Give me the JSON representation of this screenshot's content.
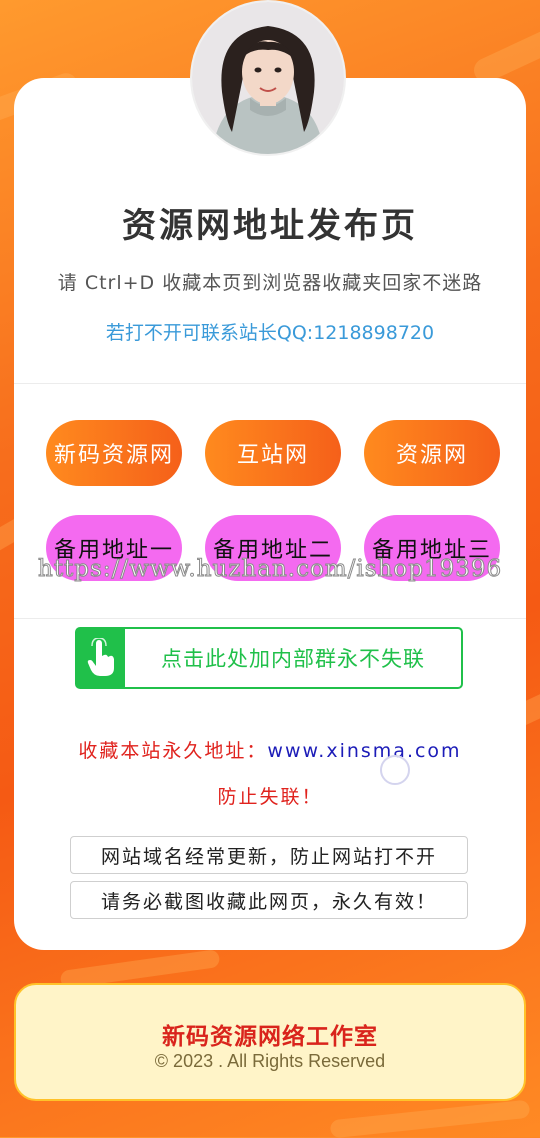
{
  "header": {
    "title": "资源网地址发布页",
    "subtitle": "请 Ctrl+D 收藏本页到浏览器收藏夹回家不迷路",
    "contact": "若打不开可联系站长QQ:1218898720"
  },
  "nav": {
    "primary": [
      {
        "label": "新码资源网"
      },
      {
        "label": "互站网"
      },
      {
        "label": "资源网"
      }
    ],
    "backup": [
      {
        "label": "备用地址一"
      },
      {
        "label": "备用地址二"
      },
      {
        "label": "备用地址三"
      }
    ]
  },
  "watermark": "https://www.huzhan.com/ishop19396",
  "group_button": {
    "label": "点击此处加内部群永不失联",
    "icon": "hand-pointer-icon"
  },
  "address": {
    "label": "收藏本站永久地址：",
    "url": "www.xinsma.com",
    "warning": "防止失联！"
  },
  "notices": [
    "网站域名经常更新，防止网站打不开",
    "请务必截图收藏此网页，永久有效！"
  ],
  "footer": {
    "title": "新码资源网络工作室",
    "copyright": "© 2023 . All Rights Reserved"
  },
  "colors": {
    "background": "#f76d1c",
    "primary_button": "#f5601a",
    "backup_button": "#f46af0",
    "group_green": "#20c04a",
    "contact_blue": "#3a9ad9",
    "warning_red": "#e0231e",
    "url_blue": "#1c1cb8",
    "footer_bg": "#fff4c8"
  }
}
